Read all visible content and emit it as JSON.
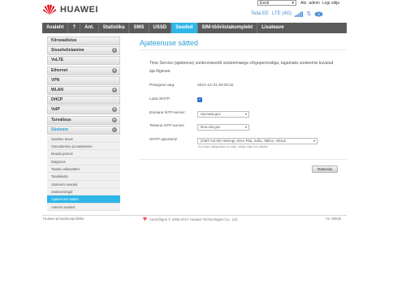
{
  "header": {
    "brand": "HUAWEI",
    "language": "Eesti",
    "links": [
      "Abi",
      "admin",
      "Logi välja"
    ],
    "operator": "Telia EE",
    "network": "LTE (4G)"
  },
  "nav": [
    "Avaleht",
    "?",
    "Ant.",
    "Statistika",
    "SMS",
    "USSD",
    "Seaded",
    "SIM-tööriistakomplekt",
    "Lisateave"
  ],
  "sidebar": {
    "items": [
      {
        "label": "Kiirseadistus",
        "plus": false
      },
      {
        "label": "Sissehelistamine",
        "plus": true
      },
      {
        "label": "VoLTE",
        "plus": false
      },
      {
        "label": "Ethernet",
        "plus": true
      },
      {
        "label": "VPN",
        "plus": false
      },
      {
        "label": "WLAN",
        "plus": true
      },
      {
        "label": "DHCP",
        "plus": false
      },
      {
        "label": "VoIP",
        "plus": true
      },
      {
        "label": "Turvalisus",
        "plus": true
      },
      {
        "label": "Süsteem",
        "plus": true
      }
    ],
    "subitems": [
      "Seadme teave",
      "Varundamine ja taastamine",
      "Muuda parooli",
      "Diagnoos",
      "Taasta vaikesätted",
      "Taaskäivita",
      "Süsteemi seaded",
      "Süsteemilogid",
      "Ajateenuse sätted",
      "Antenni seaded"
    ]
  },
  "main": {
    "title": "Ajateenuse sätted",
    "description": "Time Service (ajateenus) sünkroniseerib süsteemiaega võrguperioodiga, tagamaks süsteemis kuvatud aja õigsuse.",
    "fields": {
      "system_time_label": "Praegune aeg:",
      "system_time": "2021-12-31 20:09:32",
      "sntp_label": "Luba SNTP:",
      "primary_label": "Esmane NTP-server:",
      "primary": "ntp.nasa.gov",
      "secondary_label": "Teisene NTP-server:",
      "secondary": "time.nist.gov",
      "timezone_label": "SNTP ajavöönd:",
      "timezone": "(GMT+02:00) Helsingi, Kiiev, Riia, Sofia, Tallinn, Vilnius",
      "hint": "Kui tuleb ajaquotaid on vaja, valige õige linn käsitsi."
    },
    "apply": "Rakenda"
  },
  "footer": {
    "privacy": "Huawei privaatsuspoliitika",
    "copyright": "Autoriõigus © 2006-2017 Huawei Technologies Co., Ltd.",
    "foss": "Av. tähtak"
  },
  "colors": {
    "accent": "#2eb6e8",
    "nav_bg": "#5a5a5a",
    "brand_red": "#e60012"
  }
}
